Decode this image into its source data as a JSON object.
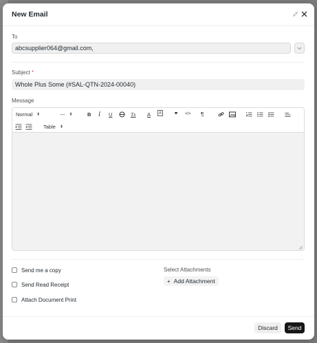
{
  "dialog": {
    "title": "New Email",
    "minimize_icon": "collapse-icon",
    "close_icon": "close-icon"
  },
  "to": {
    "label": "To",
    "value": "abcsupplier064@gmail.com,"
  },
  "subject": {
    "label": "Subject",
    "required_mark": "*",
    "value": "Whole Plus Some (#SAL-QTN-2024-00040)"
  },
  "message": {
    "label": "Message",
    "toolbar": {
      "paragraph_style": "Normal",
      "font_size": "---",
      "bold": "B",
      "italic": "I",
      "underline": "U",
      "strike": "S",
      "clear_format": "Tx",
      "text_color": "A",
      "background_color": "A",
      "blockquote": "❞",
      "code": "</>",
      "direction": "¶",
      "table": "Table"
    }
  },
  "options": {
    "send_copy": "Send me a copy",
    "read_receipt": "Send Read Receipt",
    "attach_print": "Attach Document Print"
  },
  "attachments": {
    "label": "Select Attachments",
    "add_button": "Add Attachment",
    "add_icon": "+"
  },
  "footer": {
    "discard": "Discard",
    "send": "Send"
  }
}
